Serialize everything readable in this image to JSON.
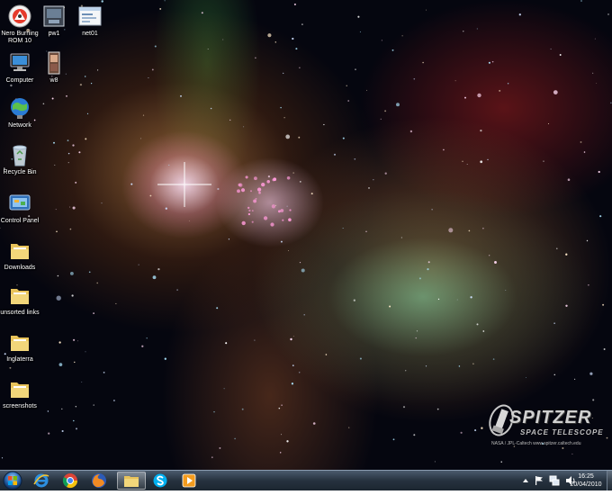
{
  "desktop": {
    "icons": [
      {
        "label": "Nero Burning ROM 10",
        "icon": "nero-icon"
      },
      {
        "label": "pw1",
        "icon": "image-file-icon"
      },
      {
        "label": "net01",
        "icon": "image-file-icon"
      },
      {
        "label": "Computer",
        "icon": "computer-icon"
      },
      {
        "label": "w8",
        "icon": "image-file-icon"
      },
      {
        "label": "Network",
        "icon": "network-icon"
      },
      {
        "label": "Recycle Bin",
        "icon": "recycle-bin-icon"
      },
      {
        "label": "Control Panel",
        "icon": "control-panel-icon"
      },
      {
        "label": "Downloads",
        "icon": "folder-icon"
      },
      {
        "label": "unsorted links",
        "icon": "folder-icon"
      },
      {
        "label": "Inglaterra",
        "icon": "folder-icon"
      },
      {
        "label": "screenshots",
        "icon": "folder-icon"
      }
    ],
    "wallpaper_logo": {
      "wordmark": "SPITZER",
      "subtitle": "SPACE TELESCOPE",
      "credit": "NASA / JPL-Caltech   www.spitzer.caltech.edu"
    }
  },
  "taskbar": {
    "pinned": [
      {
        "name": "internet-explorer",
        "icon": "internet-explorer-icon"
      },
      {
        "name": "chrome",
        "icon": "chrome-icon"
      },
      {
        "name": "firefox",
        "icon": "firefox-icon"
      },
      {
        "name": "windows-explorer",
        "icon": "folder-icon"
      },
      {
        "name": "skype",
        "icon": "skype-icon"
      },
      {
        "name": "media-player",
        "icon": "media-player-icon"
      }
    ],
    "clock": {
      "time": "16:25",
      "date": "20/04/2010"
    }
  }
}
